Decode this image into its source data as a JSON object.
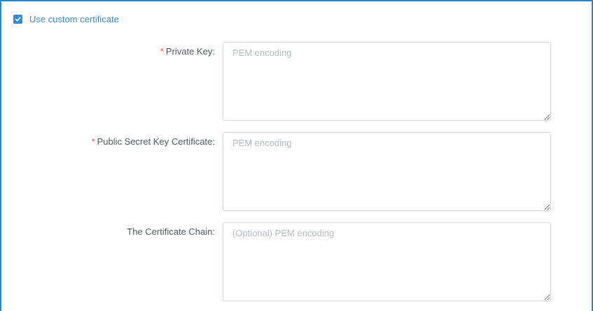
{
  "custom_certificate": {
    "checked": true,
    "label": "Use custom certificate"
  },
  "fields": {
    "private_key": {
      "required_mark": "*",
      "label": "Private Key:",
      "placeholder": "PEM encoding",
      "value": ""
    },
    "public_cert": {
      "required_mark": "*",
      "label": "Public Secret Key Certificate:",
      "placeholder": "PEM encoding",
      "value": ""
    },
    "cert_chain": {
      "label": "The Certificate Chain:",
      "placeholder": "(Optional) PEM encoding",
      "value": ""
    }
  },
  "colors": {
    "accent": "#2f8be0",
    "required": "#e25c4a",
    "label": "#555a60",
    "placeholder": "#b5b9bf",
    "border": "#d4d7dc"
  }
}
